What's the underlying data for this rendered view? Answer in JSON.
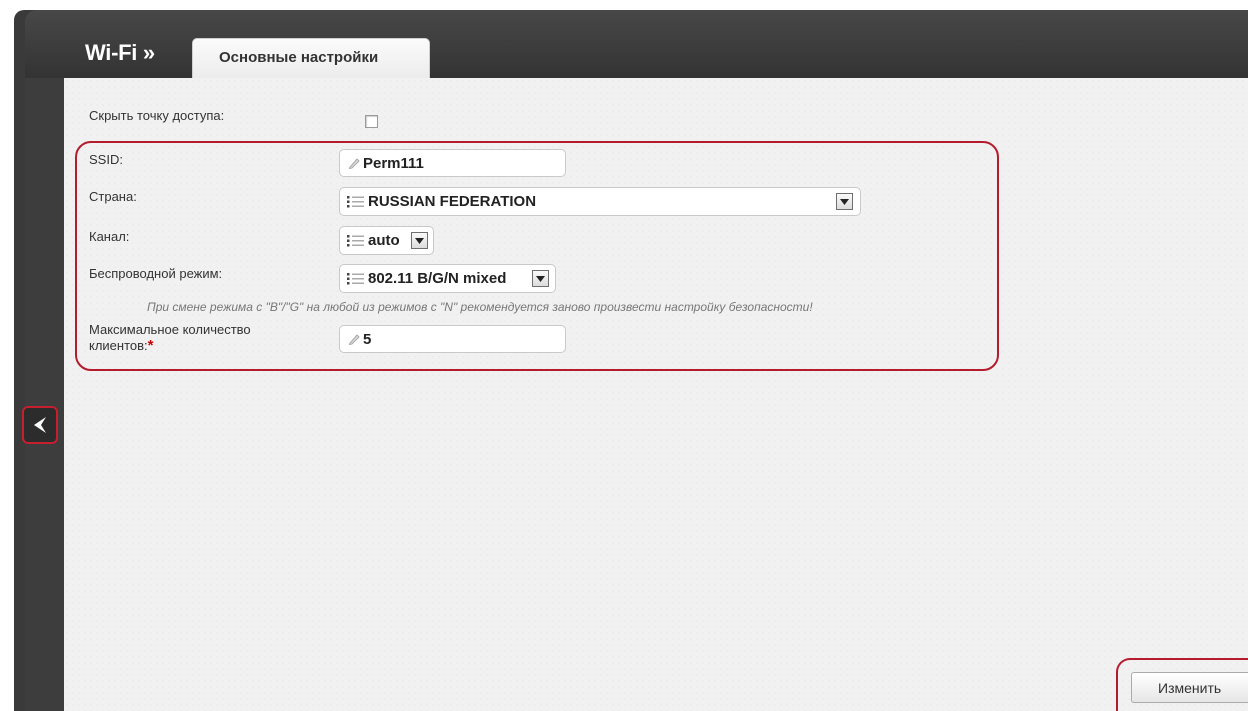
{
  "header": {
    "section_title": "Wi-Fi »",
    "tab_label": "Основные настройки"
  },
  "form": {
    "hide_ap": {
      "label": "Скрыть точку доступа:",
      "checked": false
    },
    "ssid": {
      "label": "SSID:",
      "value": "Perm111"
    },
    "country": {
      "label": "Страна:",
      "value": "RUSSIAN FEDERATION"
    },
    "channel": {
      "label": "Канал:",
      "value": "auto"
    },
    "wireless_mode": {
      "label": "Беспроводной режим:",
      "value": "802.11 B/G/N mixed"
    },
    "hint": "При смене режима с \"B\"/\"G\" на любой из режимов с \"N\" рекомендуется заново произвести настройку безопасности!",
    "max_clients": {
      "label_line1": "Максимальное количество",
      "label_line2": "клиентов:",
      "required_mark": "*",
      "value": "5"
    }
  },
  "actions": {
    "save_label": "Изменить"
  },
  "icons": {
    "back": "chevron-left-icon",
    "edit": "pencil-icon",
    "list": "list-icon",
    "dropdown": "chevron-down-icon"
  },
  "colors": {
    "highlight": "#b51b2c",
    "header_bg": "#3d3d3d",
    "content_bg": "#f1f1f1"
  }
}
